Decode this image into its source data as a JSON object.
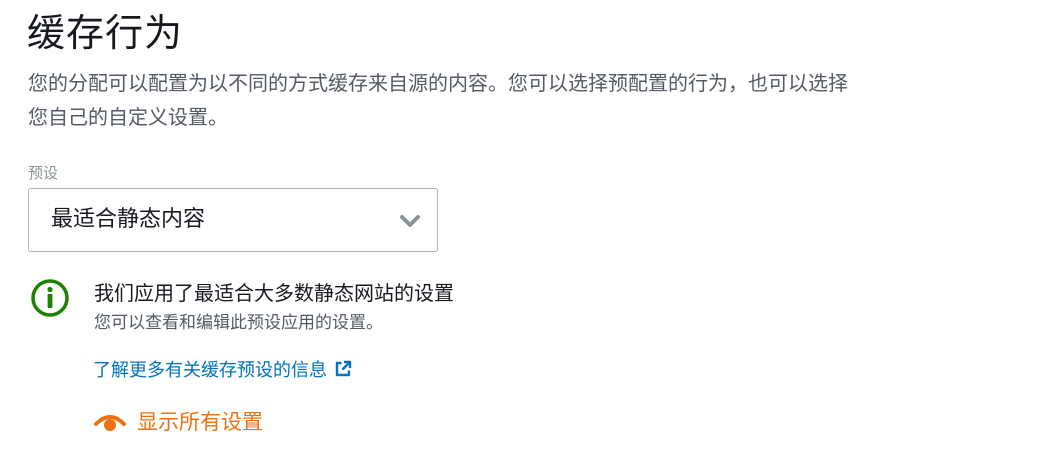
{
  "header": {
    "title": "缓存行为",
    "description": "您的分配可以配置为以不同的方式缓存来自源的内容。您可以选择预配置的行为，也可以选择您自己的自定义设置。"
  },
  "preset": {
    "label": "预设",
    "selected": "最适合静态内容",
    "icon": "chevron-down-icon"
  },
  "info": {
    "icon": "info-icon",
    "title": "我们应用了最适合大多数静态网站的设置",
    "subtitle": "您可以查看和编辑此预设应用的设置。",
    "color": "#1d8102"
  },
  "links": {
    "learn_more": "了解更多有关缓存预设的信息",
    "learn_more_icon": "external-link-icon",
    "link_color": "#0073bb"
  },
  "actions": {
    "show_all": "显示所有设置",
    "show_all_icon": "eye-icon",
    "color": "#ec7211"
  }
}
